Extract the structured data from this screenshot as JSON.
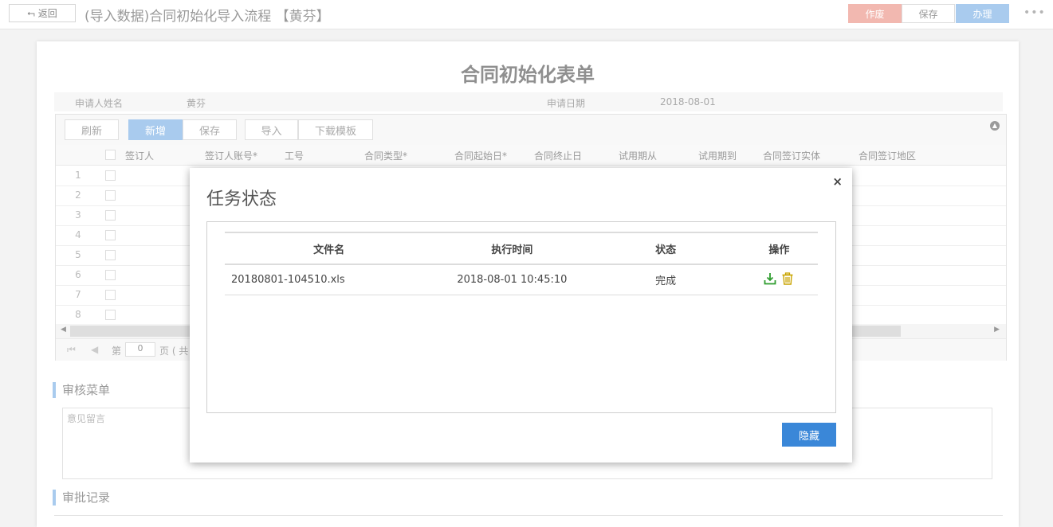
{
  "topbar": {
    "back_label": "返回",
    "title": "(导入数据)合同初始化导入流程 【黄芬】",
    "void_label": "作废",
    "save_label": "保存",
    "handle_label": "办理",
    "more_icon": "more-dots-icon"
  },
  "form": {
    "title": "合同初始化表单",
    "applicant_label": "申请人姓名",
    "applicant_value": "黄芬",
    "date_label": "申请日期",
    "date_value": "2018-08-01"
  },
  "grid": {
    "toolbar": {
      "refresh": "刷新",
      "add": "新增",
      "save": "保存",
      "import": "导入",
      "download_template": "下载模板"
    },
    "columns": [
      "签订人",
      "签订人账号",
      "工号",
      "合同类型",
      "合同起始日",
      "合同终止日",
      "试用期从",
      "试用期到",
      "合同签订实体",
      "合同签订地区"
    ],
    "required_mark": "*",
    "rows": [
      "1",
      "2",
      "3",
      "4",
      "5",
      "6",
      "7",
      "8"
    ],
    "pager": {
      "page_prefix": "第",
      "page_value": "0",
      "page_suffix": "页 ( 共"
    }
  },
  "review": {
    "title": "审核菜单",
    "placeholder": "意见留言"
  },
  "records": {
    "title": "审批记录"
  },
  "modal": {
    "title": "任务状态",
    "close_icon": "×",
    "headers": {
      "file_name": "文件名",
      "exec_time": "执行时间",
      "status": "状态",
      "actions": "操作"
    },
    "rows": [
      {
        "file_name": "20180801-104510.xls",
        "exec_time": "2018-08-01 10:45:10",
        "status": "完成"
      }
    ],
    "hide_label": "隐藏"
  },
  "colors": {
    "accent": "#3a87d8",
    "download_icon": "#2e9c2e",
    "delete_icon": "#c9a400"
  }
}
